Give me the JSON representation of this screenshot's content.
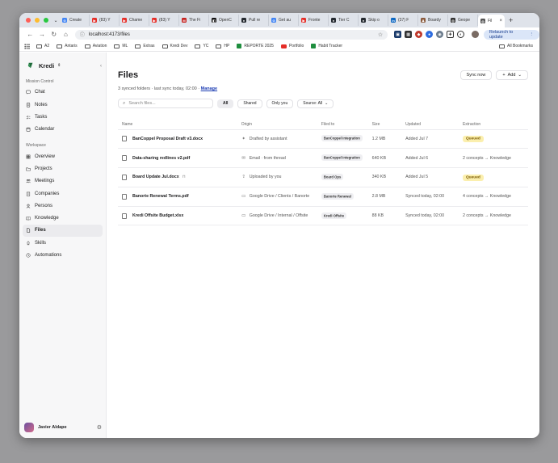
{
  "browser": {
    "tabs": [
      {
        "label": "Create",
        "color": "#4285f4",
        "glyph": "G"
      },
      {
        "label": "(83) Y",
        "color": "#e52d27",
        "glyph": "▶"
      },
      {
        "label": "Chame",
        "color": "#e52d27",
        "glyph": "▶"
      },
      {
        "label": "(83) Y",
        "color": "#e52d27",
        "glyph": "▶"
      },
      {
        "label": "The Fi",
        "color": "#c5221f",
        "glyph": "M"
      },
      {
        "label": "OpenC",
        "color": "#111111",
        "glyph": "◧"
      },
      {
        "label": "Pull re",
        "color": "#24292f",
        "glyph": "●"
      },
      {
        "label": "Get au",
        "color": "#4285f4",
        "glyph": "G"
      },
      {
        "label": "Fronte",
        "color": "#e52d27",
        "glyph": "▶"
      },
      {
        "label": "Tier C",
        "color": "#24292f",
        "glyph": "●"
      },
      {
        "label": "Skip o",
        "color": "#24292f",
        "glyph": "●"
      },
      {
        "label": "(37) F",
        "color": "#0a66c2",
        "glyph": "in"
      },
      {
        "label": "Boardy",
        "color": "#8a5a3c",
        "glyph": "♟"
      },
      {
        "label": "Geope",
        "color": "#333333",
        "glyph": "◎"
      }
    ],
    "active_tab": {
      "label": "Fil",
      "close": "×"
    },
    "new_tab": "+",
    "url": "localhost:4173/files",
    "relaunch_label": "Relaunch to update",
    "bookmarks": [
      {
        "label": "A2",
        "kind": "folder"
      },
      {
        "label": "Antaris",
        "kind": "folder"
      },
      {
        "label": "Aviation",
        "kind": "folder"
      },
      {
        "label": "ML",
        "kind": "folder"
      },
      {
        "label": "Extras",
        "kind": "folder"
      },
      {
        "label": "Kredi Dev",
        "kind": "folder"
      },
      {
        "label": "YC",
        "kind": "folder"
      },
      {
        "label": "HP",
        "kind": "folder"
      },
      {
        "label": "REPORTE 2025",
        "kind": "sheet"
      },
      {
        "label": "Portfolio",
        "kind": "youtube"
      },
      {
        "label": "Habit Tracker",
        "kind": "sheet"
      }
    ],
    "all_bookmarks": "All Bookmarks"
  },
  "sidebar": {
    "brand": "Kredi",
    "brand_color": "#1e6b3a",
    "sections": [
      {
        "label": "Mission Control",
        "items": [
          {
            "label": "Chat",
            "icon": "chat-icon"
          },
          {
            "label": "Notes",
            "icon": "notes-icon"
          },
          {
            "label": "Tasks",
            "icon": "tasks-icon"
          },
          {
            "label": "Calendar",
            "icon": "calendar-icon"
          }
        ]
      },
      {
        "label": "Workspace",
        "items": [
          {
            "label": "Overview",
            "icon": "overview-icon"
          },
          {
            "label": "Projects",
            "icon": "projects-icon"
          },
          {
            "label": "Meetings",
            "icon": "meetings-icon"
          },
          {
            "label": "Companies",
            "icon": "companies-icon"
          },
          {
            "label": "Persons",
            "icon": "persons-icon"
          },
          {
            "label": "Knowledge",
            "icon": "knowledge-icon"
          },
          {
            "label": "Files",
            "icon": "files-icon",
            "active": true
          },
          {
            "label": "Skills",
            "icon": "skills-icon"
          },
          {
            "label": "Automations",
            "icon": "automations-icon"
          }
        ]
      }
    ],
    "user": {
      "name": "Javier Aldape"
    }
  },
  "main": {
    "title": "Files",
    "sync_button": "Sync now",
    "add_button": "Add",
    "subtitle": "3 synced folders · last sync today, 02:00 · ",
    "manage_link": "Manage",
    "search_placeholder": "Search files...",
    "filters": [
      {
        "label": "All",
        "active": true
      },
      {
        "label": "Shared"
      },
      {
        "label": "Only you"
      }
    ],
    "source_filter": "Source: All",
    "columns": [
      "Name",
      "Origin",
      "Filed to",
      "Size",
      "Updated",
      "Extraction"
    ],
    "rows": [
      {
        "name": "BanCoppel Proposal Draft v3.docx",
        "origin": "Drafted by assistant",
        "origin_icon": "sparkle-icon",
        "filed_to": "BanCoppel Integration",
        "size": "1.2 MB",
        "updated": "Added Jul 7",
        "extraction": "Queued",
        "queued": true
      },
      {
        "name": "Data-sharing redlines v2.pdf",
        "origin": "Email · from thread",
        "origin_icon": "email-icon",
        "filed_to": "BanCoppel Integration",
        "size": "640 KB",
        "updated": "Added Jul 6",
        "extraction": "2 concepts → Knowledge"
      },
      {
        "name": "Board Update Jul.docx",
        "origin": "Uploaded by you",
        "origin_icon": "upload-icon",
        "filed_to": "Board Ops",
        "size": "340 KB",
        "updated": "Added Jul 5",
        "extraction": "Queued",
        "queued": true,
        "locked": true
      },
      {
        "name": "Banorte Renewal Terms.pdf",
        "origin": "Google Drive / Clients / Banorte",
        "origin_icon": "drive-icon",
        "filed_to": "Banorte Renewal",
        "size": "2.8 MB",
        "updated": "Synced today, 02:00",
        "extraction": "4 concepts → Knowledge"
      },
      {
        "name": "Kredi Offsite Budget.xlsx",
        "origin": "Google Drive / Internal / Offsite",
        "origin_icon": "drive-icon",
        "filed_to": "Kredi Offsite",
        "size": "88 KB",
        "updated": "Synced today, 02:00",
        "extraction": "2 concepts → Knowledge"
      }
    ]
  }
}
